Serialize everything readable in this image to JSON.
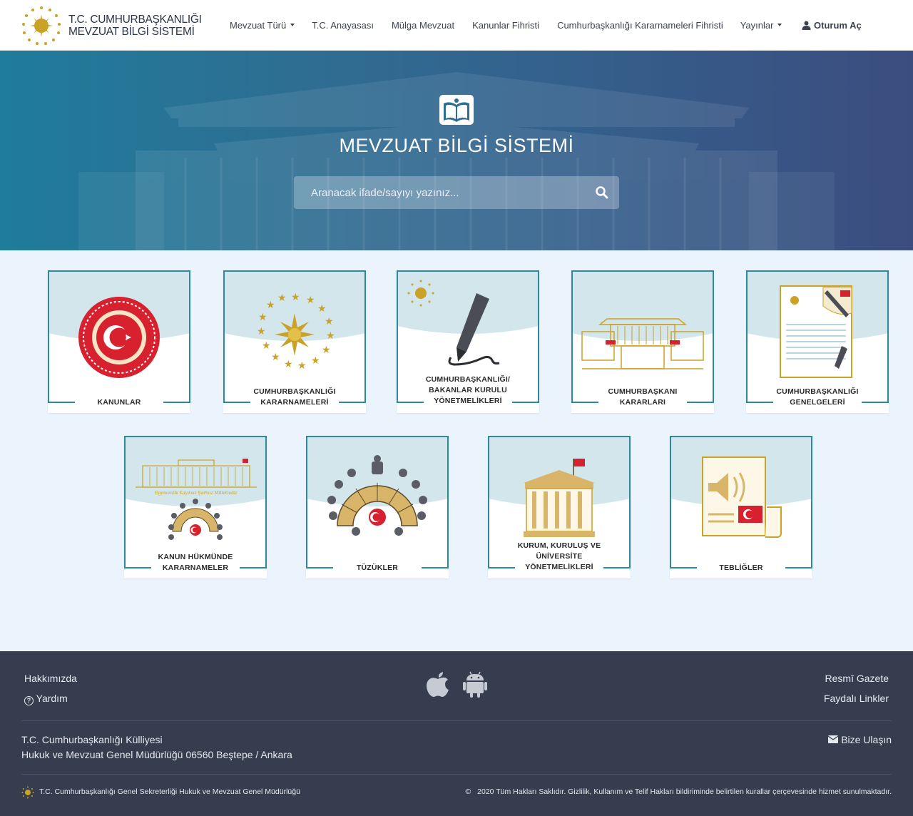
{
  "brand": {
    "line1": "T.C. CUMHURBAŞKANLIĞI",
    "line2": "MEVZUAT BİLGİ SİSTEMİ",
    "logo_icon": "presidential-seal-icon",
    "accent": "#c9a227"
  },
  "nav": {
    "items": [
      {
        "label": "Mevzuat Türü",
        "dropdown": true
      },
      {
        "label": "T.C. Anayasası",
        "dropdown": false
      },
      {
        "label": "Mülga Mevzuat",
        "dropdown": false
      },
      {
        "label": "Kanunlar Fihristi",
        "dropdown": false
      },
      {
        "label": "Cumhurbaşkanlığı Kararnameleri Fihristi",
        "dropdown": false
      },
      {
        "label": "Yayınlar",
        "dropdown": true
      }
    ],
    "login": "Oturum Aç"
  },
  "hero": {
    "title": "MEVZUAT BİLGİ SİSTEMİ",
    "search_placeholder": "Aranacak ifade/sayıyı yazınız...",
    "search_icon": "search-icon"
  },
  "cards": [
    {
      "line1": "KANUNLAR",
      "line2": "",
      "line3": "",
      "icon": "tbmm-emblem-icon"
    },
    {
      "line1": "CUMHURBAŞKANLIĞI",
      "line2": "KARARNAMELERİ",
      "line3": "",
      "icon": "presidential-star-emblem-icon"
    },
    {
      "line1": "CUMHURBAŞKANLIĞI/",
      "line2": "BAKANLAR KURULU",
      "line3": "YÖNETMELİKLERİ",
      "icon": "fountain-pen-icon"
    },
    {
      "line1": "CUMHURBAŞKANI",
      "line2": "KARARLARI",
      "line3": "",
      "icon": "presidential-complex-icon"
    },
    {
      "line1": "CUMHURBAŞKANLIĞI",
      "line2": "GENELGELERİ",
      "line3": "",
      "icon": "document-pen-icon"
    },
    {
      "line1": "KANUN HÜKMÜNDE",
      "line2": "KARARNAMELER",
      "line3": "",
      "icon": "parliament-building-icon",
      "motto": "Egemenlik Kayıtsız Şartsız Milletindir"
    },
    {
      "line1": "TÜZÜKLER",
      "line2": "",
      "line3": "",
      "icon": "assembly-hall-icon"
    },
    {
      "line1": "KURUM, KURULUŞ VE",
      "line2": "ÜNİVERSİTE",
      "line3": "YÖNETMELİKLERİ",
      "icon": "institution-building-icon"
    },
    {
      "line1": "TEBLİĞLER",
      "line2": "",
      "line3": "",
      "icon": "announcement-document-icon"
    }
  ],
  "footer": {
    "about": "Hakkımızda",
    "help": "Yardım",
    "gazette": "Resmî Gazete",
    "links": "Faydalı Linkler",
    "address1": "T.C. Cumhurbaşkanlığı Külliyesi",
    "address2": "Hukuk ve Mevzuat Genel Müdürlüğü 06560 Beştepe / Ankara",
    "contact": "Bize Ulaşın",
    "org": "T.C. Cumhurbaşkanlığı Genel Sekreterliği Hukuk ve Mevzuat Genel Müdürlüğü",
    "copyright": "2020 Tüm Hakları Saklıdır. Gizlilik, Kullanım ve Telif Hakları bildiriminde belirtilen kurallar çerçevesinde hizmet sunulmaktadır.",
    "apps": [
      "apple-icon",
      "android-icon"
    ]
  },
  "colors": {
    "teal": "#2c8a9c",
    "gold": "#c9a227",
    "footer_bg": "#353d4e",
    "page_bg": "#ebf3fd"
  }
}
